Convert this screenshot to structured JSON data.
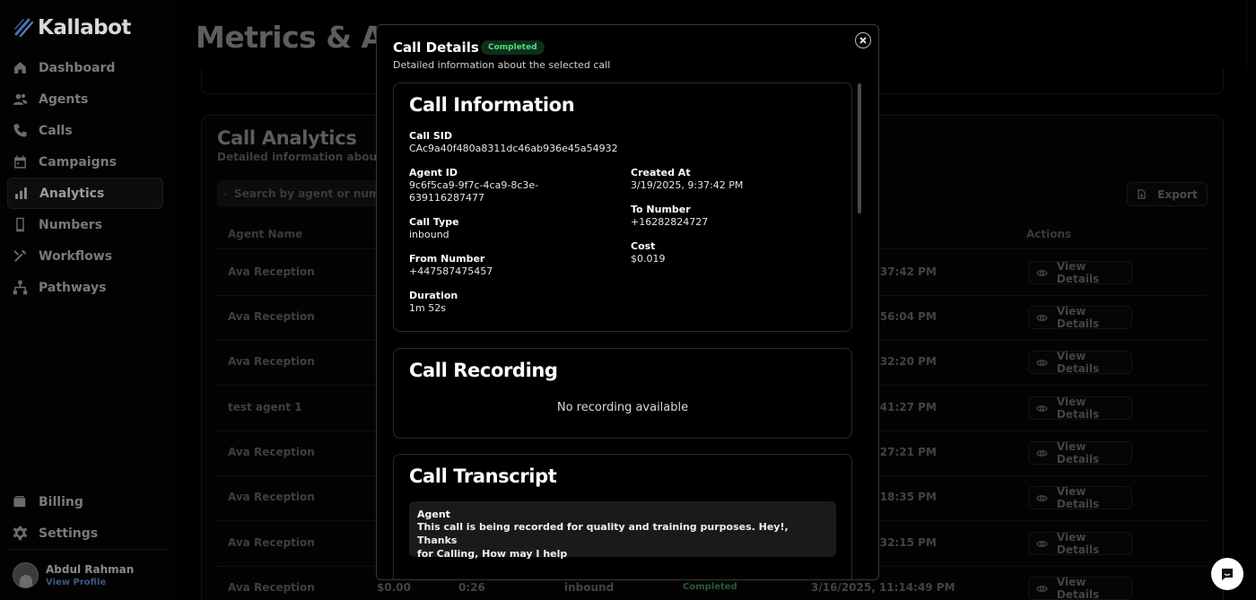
{
  "app": {
    "brand": "Kallabot"
  },
  "sidebar": {
    "items": [
      {
        "label": "Dashboard",
        "icon": "home-icon"
      },
      {
        "label": "Agents",
        "icon": "users-icon"
      },
      {
        "label": "Calls",
        "icon": "phone-icon"
      },
      {
        "label": "Campaigns",
        "icon": "calendar-icon"
      },
      {
        "label": "Analytics",
        "icon": "bar-chart-icon",
        "active": true
      },
      {
        "label": "Numbers",
        "icon": "smartphone-icon"
      },
      {
        "label": "Workflows",
        "icon": "tools-icon"
      },
      {
        "label": "Pathways",
        "icon": "network-icon"
      }
    ],
    "bottom_items": [
      {
        "label": "Billing",
        "icon": "wallet-icon"
      },
      {
        "label": "Settings",
        "icon": "gear-icon"
      }
    ],
    "profile": {
      "name": "Abdul Rahman",
      "link": "View Profile"
    }
  },
  "page": {
    "title": "Metrics & Ana",
    "call_analytics": {
      "title": "Call Analytics",
      "subtitle": "Detailed information about yo",
      "search_placeholder": "Search by agent or numb",
      "export_label": "Export",
      "columns": {
        "agent": "Agent Name",
        "actions": "Actions"
      },
      "rows": [
        {
          "agent": "Ava Reception",
          "time": ":37:42 PM"
        },
        {
          "agent": "Ava Reception",
          "time": ":56:04 PM"
        },
        {
          "agent": "Ava Reception",
          "time": ":32:20 PM"
        },
        {
          "agent": "test agent 1",
          "time": ":41:27 PM"
        },
        {
          "agent": "Ava Reception",
          "time": ":27:21 PM"
        },
        {
          "agent": "Ava Reception",
          "time": ":18:35 PM"
        },
        {
          "agent": "Ava Reception",
          "time": ":32:15 PM"
        },
        {
          "agent": "Ava Reception",
          "cost": "$0.00",
          "duration": "0:26",
          "type": "inbound",
          "status": "Completed",
          "time": "3/16/2025, 11:14:49 PM"
        }
      ],
      "view_label": "View Details"
    }
  },
  "modal": {
    "title": "Call Details",
    "badge": "Completed",
    "subtitle": "Detailed information about the selected call",
    "info": {
      "title": "Call Information",
      "call_sid_label": "Call SID",
      "call_sid": "CAc9a40f480a8311dc46ab936e45a54932",
      "agent_id_label": "Agent ID",
      "agent_id_line1": "9c6f5ca9-9f7c-4ca9-8c3e-",
      "agent_id_line2": "639116287477",
      "created_at_label": "Created At",
      "created_at": "3/19/2025, 9:37:42 PM",
      "call_type_label": "Call Type",
      "call_type": "inbound",
      "to_number_label": "To Number",
      "to_number": "+16282824727",
      "from_number_label": "From Number",
      "from_number": "+447587475457",
      "cost_label": "Cost",
      "cost": "$0.019",
      "duration_label": "Duration",
      "duration": "1m 52s"
    },
    "recording": {
      "title": "Call Recording",
      "empty": "No recording available"
    },
    "transcript": {
      "title": "Call Transcript",
      "messages": [
        {
          "role": "Agent",
          "line1": "This call is being recorded for quality and training purposes. Hey!, Thanks",
          "line2": "for Calling, How may I help"
        }
      ]
    }
  },
  "colors": {
    "badge_bg": "#0f2e18",
    "badge_text": "#4ade80",
    "accent_link": "#3c5a80"
  }
}
